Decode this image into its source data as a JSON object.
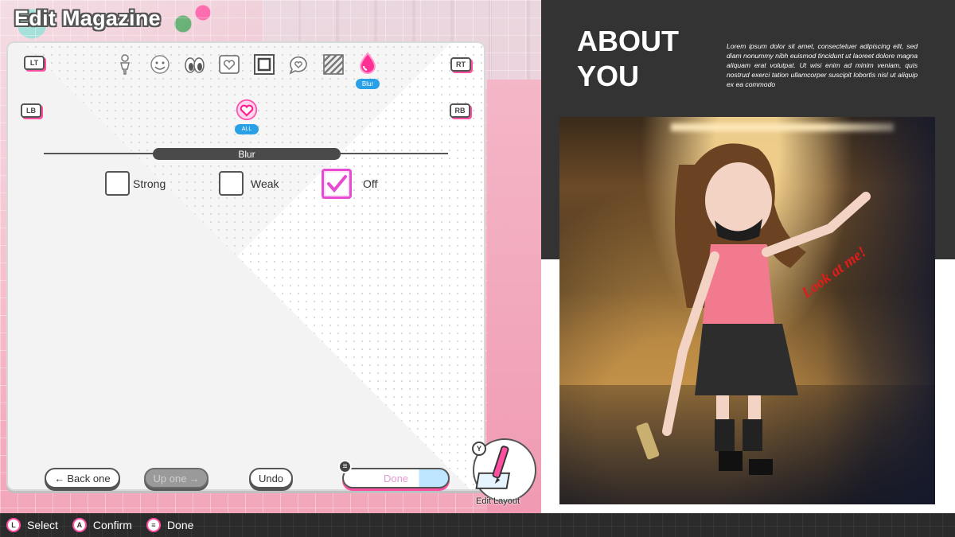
{
  "title": "Edit Magazine",
  "shoulders": {
    "lt": "LT",
    "rt": "RT",
    "lb": "LB",
    "rb": "RB"
  },
  "categories": [
    "figure-icon",
    "smile-icon",
    "eyes-icon",
    "heart-frame-icon",
    "square-frame-icon",
    "speech-heart-icon",
    "stripes-icon",
    "drop-icon"
  ],
  "selected_category_tag": "Blur",
  "subcategory_tag": "ALL",
  "section_label": "Blur",
  "options": [
    {
      "label": "Strong",
      "checked": false
    },
    {
      "label": "Weak",
      "checked": false
    },
    {
      "label": "Off",
      "checked": true
    }
  ],
  "buttons": {
    "back": "Back one",
    "up": "Up one",
    "undo": "Undo",
    "done": "Done"
  },
  "edit_layout": {
    "glyph": "Y",
    "label": "Edit Layout"
  },
  "magazine": {
    "heading": "ABOUT YOU",
    "lorem": "Lorem ipsum dolor sit amet, consectetuer adipiscing elit, sed diam nonummy nibh euismod tincidunt ut laoreet dolore magna aliquam erat volutpat. Ut wisi enim ad minim veniam, quis nostrud exerci tation ullamcorper suscipit lobortis nisl ut aliquip ex ea commodo",
    "sticker": "Look at me!"
  },
  "hints": [
    {
      "glyph": "L",
      "label": "Select"
    },
    {
      "glyph": "A",
      "label": "Confirm"
    },
    {
      "glyph": "≡",
      "label": "Done"
    }
  ],
  "colors": {
    "accent": "#ff4fa0",
    "tag": "#2aa0e6",
    "check": "#e64bd2",
    "dark": "#333333"
  }
}
